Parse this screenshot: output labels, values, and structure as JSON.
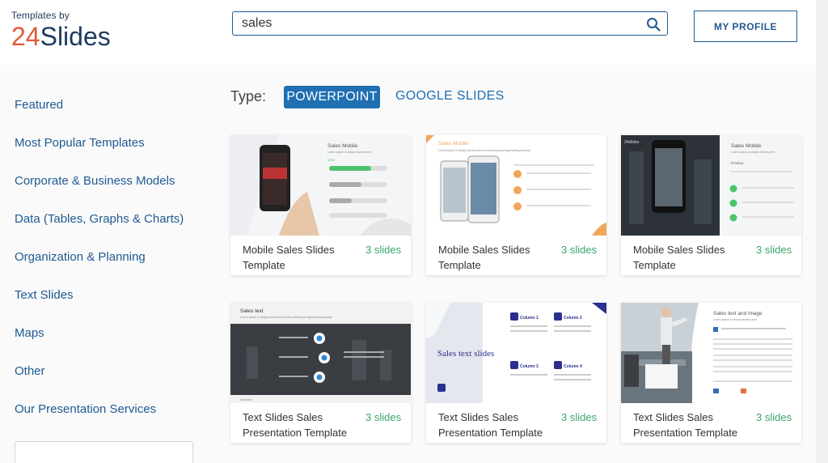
{
  "header": {
    "logo_small": "Templates by",
    "logo_num": "24",
    "logo_word": "Slides",
    "search": {
      "value": "sales"
    },
    "profile_button": "MY PROFILE"
  },
  "sidebar": {
    "items": [
      {
        "label": "Featured"
      },
      {
        "label": "Most Popular Templates"
      },
      {
        "label": "Corporate & Business Models"
      },
      {
        "label": "Data (Tables, Graphs & Charts)"
      },
      {
        "label": "Organization & Planning"
      },
      {
        "label": "Text Slides"
      },
      {
        "label": "Maps"
      },
      {
        "label": "Other"
      },
      {
        "label": "Our Presentation Services"
      }
    ]
  },
  "filter": {
    "label": "Type:",
    "options": [
      {
        "label": "POWERPOINT",
        "active": true
      },
      {
        "label": "GOOGLE SLIDES",
        "active": false
      }
    ]
  },
  "cards": [
    {
      "title": "Mobile Sales Slides Template",
      "count": "3 slides",
      "thumb": {
        "heading": "Sales Mobile",
        "text": "Lorem ipsum is simply dummy text",
        "label": "2015"
      }
    },
    {
      "title": "Mobile Sales Slides Template",
      "count": "3 slides",
      "thumb": {
        "heading": "Sales Mobile",
        "text": "Lorem ipsum is simply dummy text of the printing and typesetting industry"
      }
    },
    {
      "title": "Mobile Sales Slides Template",
      "count": "3 slides",
      "thumb": {
        "heading": "Sales Mobile",
        "text": "Lorem ipsum is simply dummy text",
        "label": "Product"
      }
    },
    {
      "title": "Text Slides Sales Presentation Template",
      "count": "3 slides",
      "thumb": {
        "heading": "Sales text",
        "text": "Lorem ipsum is simply dummy text of the printing and typesetting industry",
        "label": "24slides"
      }
    },
    {
      "title": "Text Slides Sales Presentation Template",
      "count": "3 slides",
      "thumb": {
        "heading": "Sales text slides",
        "label": "Column 1"
      }
    },
    {
      "title": "Text Slides Sales Presentation Template",
      "count": "3 slides",
      "thumb": {
        "heading": "Sales text and image",
        "text": "Lorem ipsum is simply dummy text"
      }
    }
  ],
  "colors": {
    "primary": "#1f5a92",
    "accent_button": "#1f6fb2",
    "logo_num": "#e05a3a",
    "slide_count": "#3aa56a"
  }
}
